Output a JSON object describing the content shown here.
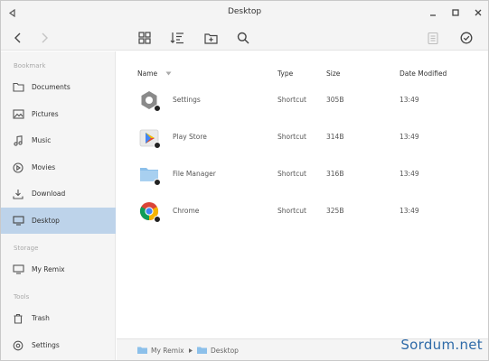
{
  "window": {
    "title": "Desktop"
  },
  "titlebar": {
    "back_icon": "triangle-left-icon",
    "minimize_icon": "minimize-icon",
    "maximize_icon": "maximize-icon",
    "close_icon": "close-icon"
  },
  "toolbar": {
    "buttons": [
      "chevron-left-icon",
      "chevron-right-icon",
      "grid-view-icon",
      "sort-icon",
      "new-folder-icon",
      "search-icon",
      "clipboard-icon",
      "check-circle-icon"
    ]
  },
  "sidebar": {
    "sections": [
      {
        "label": "Bookmark"
      },
      {
        "label": "Storage"
      },
      {
        "label": "Tools"
      }
    ],
    "items": [
      {
        "label": "Documents",
        "icon": "folder-icon"
      },
      {
        "label": "Pictures",
        "icon": "image-icon"
      },
      {
        "label": "Music",
        "icon": "music-note-icon"
      },
      {
        "label": "Movies",
        "icon": "play-circle-icon"
      },
      {
        "label": "Download",
        "icon": "download-icon"
      },
      {
        "label": "Desktop",
        "icon": "monitor-icon",
        "active": true
      },
      {
        "label": "My Remix",
        "icon": "monitor-icon"
      },
      {
        "label": "Trash",
        "icon": "trash-icon"
      },
      {
        "label": "Settings",
        "icon": "gear-icon"
      }
    ]
  },
  "table": {
    "headers": {
      "name": "Name",
      "type": "Type",
      "size": "Size",
      "date": "Date Modified"
    },
    "rows": [
      {
        "name": "Settings",
        "type": "Shortcut",
        "size": "305B",
        "date": "13:49",
        "icon": "settings-app-icon"
      },
      {
        "name": "Play Store",
        "type": "Shortcut",
        "size": "314B",
        "date": "13:49",
        "icon": "play-store-icon"
      },
      {
        "name": "File Manager",
        "type": "Shortcut",
        "size": "316B",
        "date": "13:49",
        "icon": "folder-icon"
      },
      {
        "name": "Chrome",
        "type": "Shortcut",
        "size": "325B",
        "date": "13:49",
        "icon": "chrome-icon"
      }
    ]
  },
  "statusbar": {
    "crumbs": [
      "My Remix",
      "Desktop"
    ]
  },
  "watermark": "Sordum.net",
  "colors": {
    "active_bg": "#bdd3ea",
    "folder": "#8cc0ea",
    "watermark": "#2e6aa8"
  }
}
